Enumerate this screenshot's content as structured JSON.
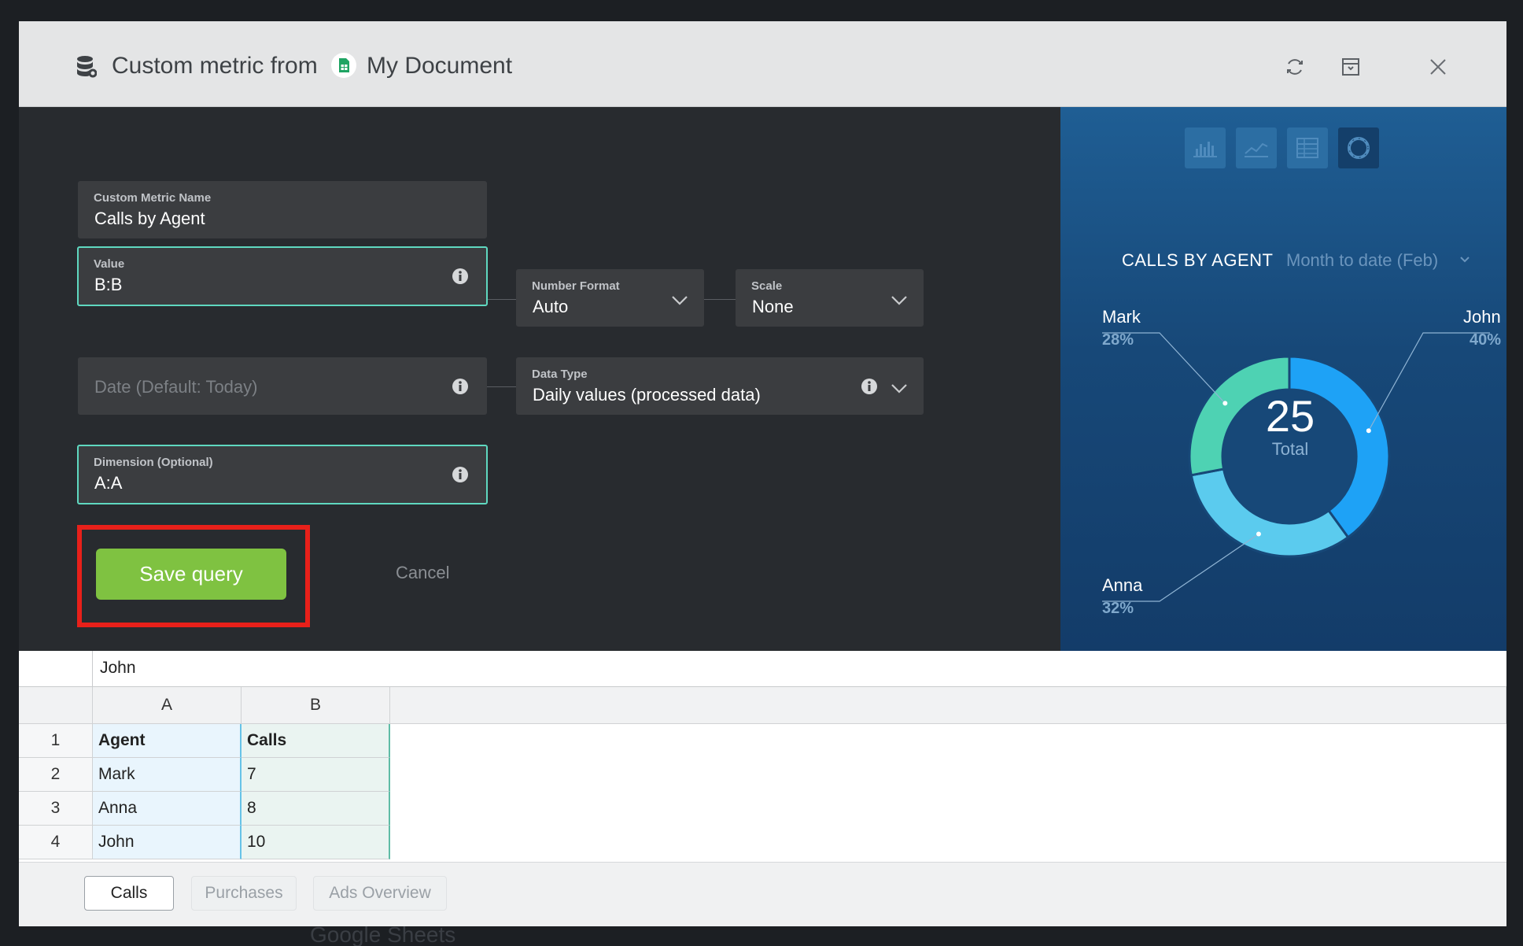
{
  "backdrop": {
    "text": "Google Sheets"
  },
  "header": {
    "title": "Custom metric from",
    "document": "My Document",
    "icons": [
      "database-settings-icon",
      "google-sheets-icon",
      "refresh-icon",
      "archive-icon",
      "close-icon"
    ]
  },
  "form": {
    "metric_name": {
      "label": "Custom Metric Name",
      "value": "Calls by Agent"
    },
    "value_field": {
      "label": "Value",
      "value": "B:B"
    },
    "number_format": {
      "label": "Number Format",
      "value": "Auto"
    },
    "scale": {
      "label": "Scale",
      "value": "None"
    },
    "date_field": {
      "placeholder": "Date (Default: Today)"
    },
    "data_type": {
      "label": "Data Type",
      "value": "Daily values (processed data)"
    },
    "dimension": {
      "label": "Dimension (Optional)",
      "value": "A:A"
    },
    "save_label": "Save query",
    "cancel_label": "Cancel"
  },
  "chart_panel": {
    "title": "CALLS BY AGENT",
    "range": "Month to date (Feb)",
    "view_icons": [
      "bar-chart-icon",
      "line-chart-icon",
      "table-icon",
      "donut-chart-icon"
    ],
    "active_view": "donut-chart-icon",
    "center_value": "25",
    "center_label": "Total",
    "labels": [
      {
        "name": "Mark",
        "pct": "28%"
      },
      {
        "name": "John",
        "pct": "40%"
      },
      {
        "name": "Anna",
        "pct": "32%"
      }
    ],
    "colors": {
      "John": "#1ea2f6",
      "Anna": "#5bcbee",
      "Mark": "#4ed2b3"
    }
  },
  "chart_data": {
    "type": "pie",
    "title": "CALLS BY AGENT",
    "subtitle": "Month to date (Feb)",
    "categories": [
      "John",
      "Anna",
      "Mark"
    ],
    "values": [
      40,
      32,
      28
    ],
    "total": 25
  },
  "sheet": {
    "formula_value": "John",
    "columns": [
      "A",
      "B"
    ],
    "rows": [
      {
        "num": "1",
        "a": "Agent",
        "b": "Calls"
      },
      {
        "num": "2",
        "a": "Mark",
        "b": "7"
      },
      {
        "num": "3",
        "a": "Anna",
        "b": "8"
      },
      {
        "num": "4",
        "a": "John",
        "b": "10"
      }
    ],
    "tabs": [
      "Calls",
      "Purchases",
      "Ads Overview"
    ],
    "active_tab": "Calls"
  }
}
